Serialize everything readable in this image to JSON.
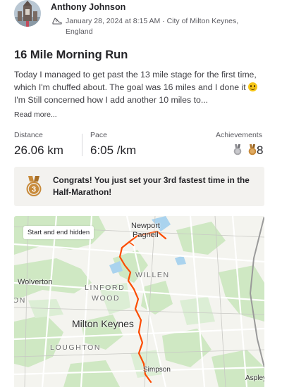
{
  "activity": {
    "athlete_name": "Anthony Johnson",
    "datetime_location": "January 28, 2024 at 8:15 AM · City of Milton Keynes, England",
    "title": "16 Mile Morning Run",
    "description_before_emoji": "Today I managed to get past the 13 mile stage for the first time, which I'm chuffed about. The goal was 16 miles and I done it ",
    "description_after_emoji": " I'm Still concerned how I add another 10 miles to...",
    "read_more": "Read more..."
  },
  "stats": {
    "distance_label": "Distance",
    "distance_value": "26.06 km",
    "pace_label": "Pace",
    "pace_value": "6:05 /km",
    "achievements_label": "Achievements",
    "achievements_count": "8"
  },
  "achievement_banner": {
    "medal_number": "3",
    "text": "Congrats! You just set your 3rd fastest time in the Half-Marathon!"
  },
  "map": {
    "privacy_note": "Start and end hidden",
    "places": {
      "newport_1": "Newport",
      "newport_2": "Pagnell",
      "willen": "WILLEN",
      "wolverton": "Wolverton",
      "linford_1": "LINFORD",
      "linford_2": "WOOD",
      "milton_keynes": "Milton Keynes",
      "loughton": "LOUGHTON",
      "simpson": "Simpson",
      "aspley": "Aspley",
      "edge_on": "ON"
    }
  },
  "colors": {
    "route": "#fc4c02",
    "bronze": "#c88a3a",
    "silver": "#a7a7ab",
    "banner_bg": "#f3f2ef"
  },
  "icons": {
    "shoe": "running-shoe-icon",
    "silver_medal": "silver-medal-icon",
    "bronze_medal": "bronze-medal-icon"
  }
}
